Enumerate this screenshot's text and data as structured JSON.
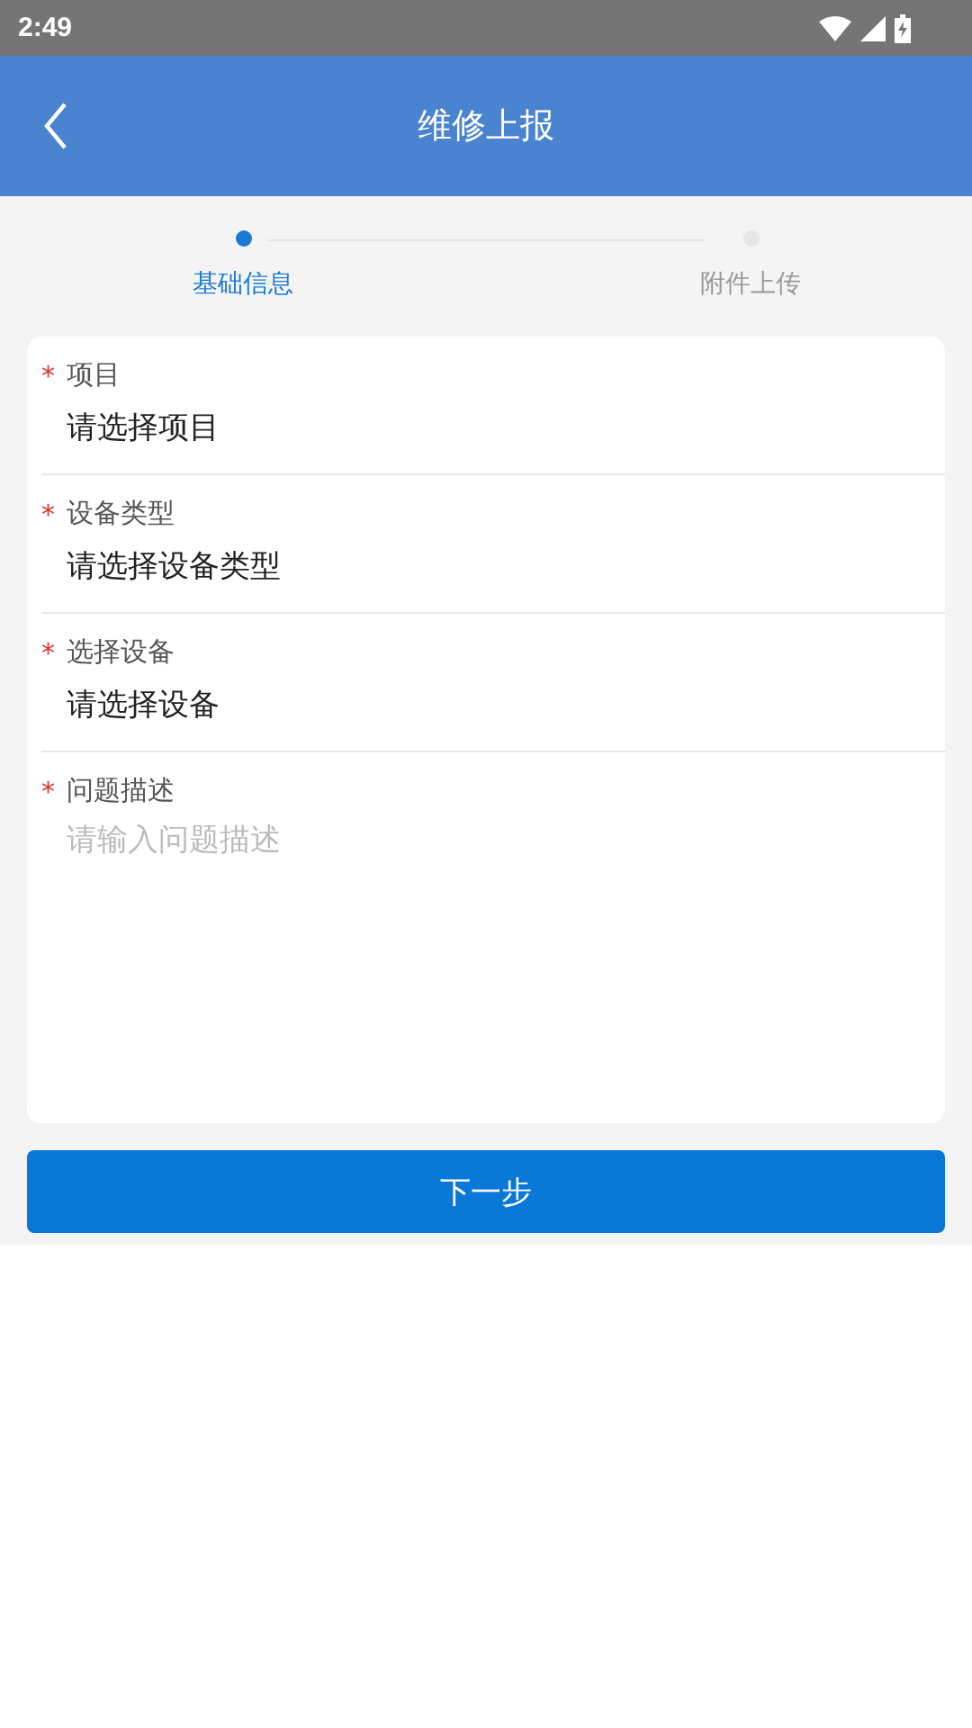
{
  "status_bar": {
    "time": "2:49"
  },
  "header": {
    "title": "维修上报"
  },
  "steps": [
    {
      "label": "基础信息",
      "selected": true
    },
    {
      "label": "附件上传",
      "selected": false
    }
  ],
  "form": {
    "fields": [
      {
        "kind": "select",
        "required_mark": "*",
        "label": "项目",
        "value": "请选择项目"
      },
      {
        "kind": "select",
        "required_mark": "*",
        "label": "设备类型",
        "value": "请选择设备类型"
      },
      {
        "kind": "select",
        "required_mark": "*",
        "label": "选择设备",
        "value": "请选择设备"
      },
      {
        "kind": "textarea",
        "required_mark": "*",
        "label": "问题描述",
        "placeholder": "请输入问题描述"
      }
    ]
  },
  "next_button": "下一步"
}
